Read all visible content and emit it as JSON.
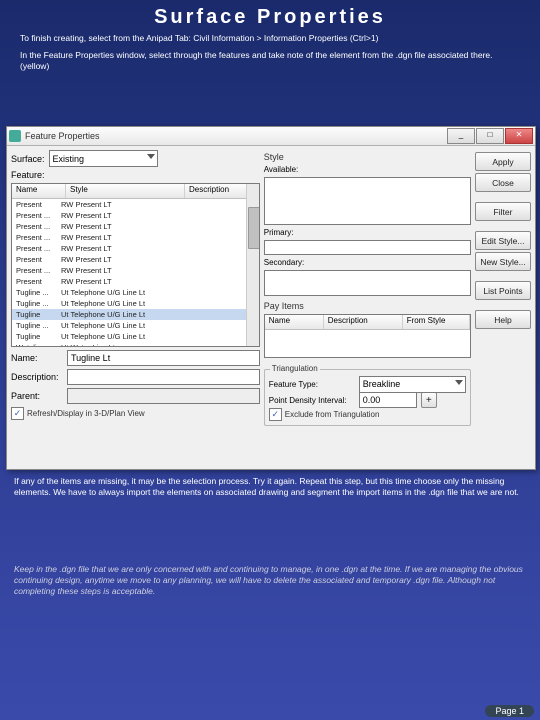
{
  "slide": {
    "title": "Surface Properties",
    "sub1": "To finish creating, select from the Anipad Tab: Civil Information > Information Properties (Ctrl>1)",
    "sub2": "In the Feature Properties window, select through the features and take note of the element from the .dgn file associated there. (yellow)",
    "body1": "If any of the items are missing, it may be the selection process. Try it again. Repeat this step, but this time choose only the missing elements. We have to always import the elements on associated drawing and segment the import items in the .dgn file that we are not.",
    "body2": "Keep in the .dgn file that we are only concerned with and continuing to manage, in one .dgn at the time. If we are managing the obvious continuing design, anytime we move to any planning, we will have to delete the associated and temporary .dgn file. Although not completing these steps is acceptable.",
    "pagenum": "Page 1"
  },
  "dialog": {
    "title": "Feature Properties",
    "surface_lbl": "Surface:",
    "surface_val": "Existing",
    "feature_lbl": "Feature:",
    "cols": {
      "c1": "Name",
      "c2": "Style",
      "c3": "Description"
    },
    "rows": [
      {
        "a": "Present",
        "b": "RW Present LT"
      },
      {
        "a": "Present ...",
        "b": "RW Present LT"
      },
      {
        "a": "Present ...",
        "b": "RW Present LT"
      },
      {
        "a": "Present ...",
        "b": "RW Present LT"
      },
      {
        "a": "Present ...",
        "b": "RW Present LT"
      },
      {
        "a": "Present",
        "b": "RW Present LT"
      },
      {
        "a": "Present ...",
        "b": "RW Present LT"
      },
      {
        "a": "Present",
        "b": "RW Present LT"
      },
      {
        "a": "Tugline ...",
        "b": "Ut Telephone U/G Line Lt"
      },
      {
        "a": "Tugline ...",
        "b": "Ut Telephone U/G Line Lt"
      },
      {
        "a": "Tugline",
        "b": "Ut Telephone U/G Line Lt"
      },
      {
        "a": "Tugline ...",
        "b": "Ut Telephone U/G Line Lt"
      },
      {
        "a": "Tugline",
        "b": "Ut Telephone U/G Line Lt"
      },
      {
        "a": "Watelin",
        "b": "Ut Water Line Lt"
      }
    ],
    "name_lbl": "Name:",
    "name_val": "Tugline Lt",
    "desc_lbl": "Description:",
    "parent_lbl": "Parent:",
    "refresh": "Refresh/Display in 3-D/Plan View",
    "style_lbl": "Style",
    "available_lbl": "Available:",
    "primary_lbl": "Primary:",
    "secondary_lbl": "Secondary:",
    "payitems_lbl": "Pay Items",
    "pi_cols": {
      "c1": "Name",
      "c2": "Description",
      "c3": "From Style"
    },
    "tri_lbl": "Triangulation",
    "ftype_lbl": "Feature Type:",
    "ftype_val": "Breakline",
    "pdens_lbl": "Point Density Interval:",
    "pdens_val": "0.00",
    "exclude": "Exclude from Triangulation",
    "btns": {
      "apply": "Apply",
      "close": "Close",
      "filter": "Filter",
      "editstyle": "Edit Style...",
      "newstyle": "New Style...",
      "listpts": "List Points",
      "help": "Help"
    }
  }
}
